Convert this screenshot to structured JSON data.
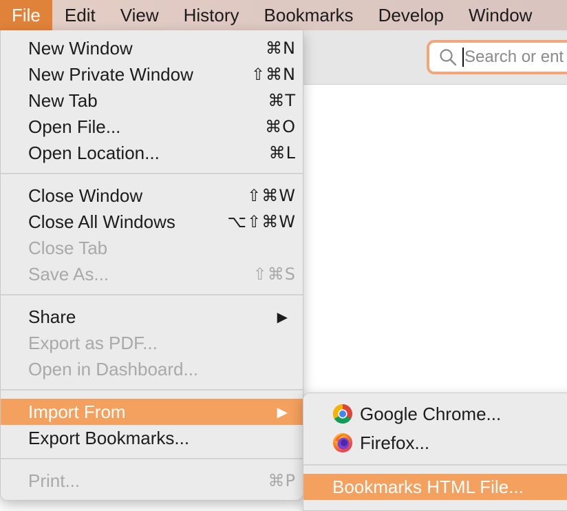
{
  "menubar": {
    "items": [
      "File",
      "Edit",
      "View",
      "History",
      "Bookmarks",
      "Develop",
      "Window"
    ]
  },
  "toolbar": {
    "search_placeholder": "Search or ent"
  },
  "file_menu": {
    "new_window": {
      "label": "New Window",
      "shortcut": "⌘N"
    },
    "new_private_window": {
      "label": "New Private Window",
      "shortcut": "⇧⌘N"
    },
    "new_tab": {
      "label": "New Tab",
      "shortcut": "⌘T"
    },
    "open_file": {
      "label": "Open File...",
      "shortcut": "⌘O"
    },
    "open_location": {
      "label": "Open Location...",
      "shortcut": "⌘L"
    },
    "close_window": {
      "label": "Close Window",
      "shortcut": "⇧⌘W"
    },
    "close_all_windows": {
      "label": "Close All Windows",
      "shortcut": "⌥⇧⌘W"
    },
    "close_tab": {
      "label": "Close Tab"
    },
    "save_as": {
      "label": "Save As...",
      "shortcut": "⇧⌘S"
    },
    "share": {
      "label": "Share",
      "arrow": "▶"
    },
    "export_pdf": {
      "label": "Export as PDF..."
    },
    "open_dashboard": {
      "label": "Open in Dashboard..."
    },
    "import_from": {
      "label": "Import From",
      "arrow": "▶"
    },
    "export_bookmarks": {
      "label": "Export Bookmarks..."
    },
    "print": {
      "label": "Print...",
      "shortcut": "⌘P"
    }
  },
  "import_submenu": {
    "chrome": {
      "label": "Google Chrome...",
      "icon": "chrome-icon"
    },
    "firefox": {
      "label": "Firefox...",
      "icon": "firefox-icon"
    },
    "bookmarks_html": {
      "label": "Bookmarks HTML File..."
    }
  },
  "colors": {
    "menubar_active": "#e1823a",
    "highlight": "#f4a05e",
    "menu_bg": "#ebebeb",
    "disabled_text": "#a9a9a9",
    "search_focus_ring": "#f0a77a"
  }
}
